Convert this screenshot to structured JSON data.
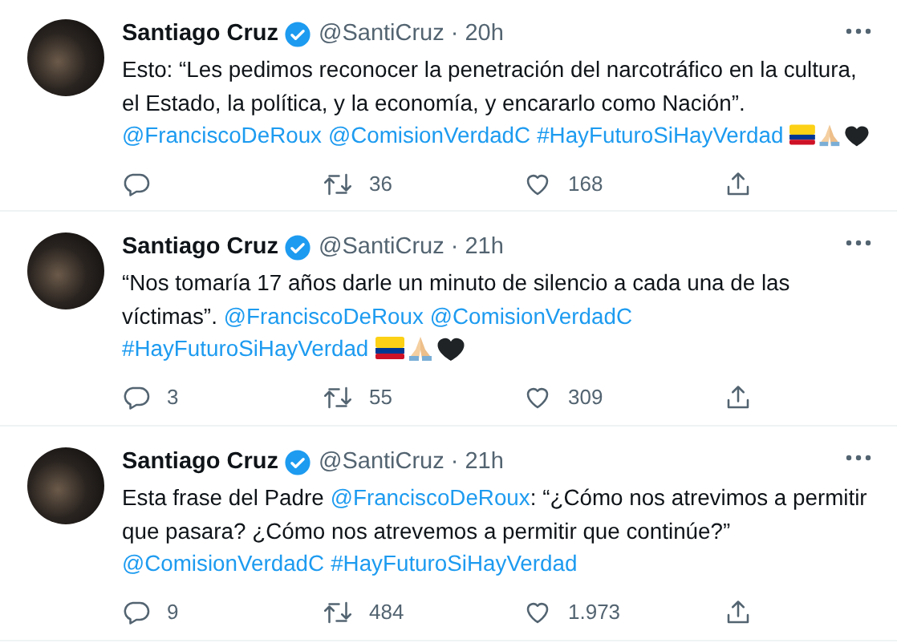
{
  "tweets": [
    {
      "name": "Santiago Cruz",
      "verified": true,
      "handle": "@SantiCruz",
      "separator": "·",
      "time": "20h",
      "lines": [
        [
          {
            "kind": "text",
            "text": "Esto: “Les pedimos reconocer la penetración del narcotráfico en la cultura,"
          }
        ],
        [
          {
            "kind": "text",
            "text": "el Estado, la política, y la economía, y encararlo como Nación”."
          }
        ],
        [
          {
            "kind": "link",
            "text": "@FranciscoDeRoux"
          },
          {
            "kind": "link",
            "text": "@ComisionVerdadC"
          },
          {
            "kind": "link",
            "text": "#HayFuturoSiHayVerdad"
          },
          {
            "kind": "flag"
          },
          {
            "kind": "hands"
          },
          {
            "kind": "heart"
          }
        ]
      ],
      "actions": [
        {
          "kind": "reply"
        },
        {
          "kind": "retweet",
          "count": "36"
        },
        {
          "kind": "like",
          "count": "168"
        },
        {
          "kind": "share"
        }
      ]
    },
    {
      "name": "Santiago Cruz",
      "verified": true,
      "handle": "@SantiCruz",
      "separator": "·",
      "time": "21h",
      "lines": [
        [
          {
            "kind": "text",
            "text": "“Nos tomaría 17 años darle un minuto de silencio a cada una de las"
          }
        ],
        [
          {
            "kind": "text",
            "text": "víctimas”."
          },
          {
            "kind": "link",
            "text": "@FranciscoDeRoux"
          },
          {
            "kind": "link",
            "text": "@ComisionVerdadC"
          }
        ],
        [
          {
            "kind": "link",
            "text": "#HayFuturoSiHayVerdad"
          },
          {
            "kind": "flag"
          },
          {
            "kind": "hands"
          },
          {
            "kind": "heart"
          }
        ]
      ],
      "actions": [
        {
          "kind": "reply",
          "count": "3"
        },
        {
          "kind": "retweet",
          "count": "55"
        },
        {
          "kind": "like",
          "count": "309"
        },
        {
          "kind": "share"
        }
      ]
    },
    {
      "name": "Santiago Cruz",
      "verified": true,
      "handle": "@SantiCruz",
      "separator": "·",
      "time": "21h",
      "lines": [
        [
          {
            "kind": "text",
            "text": "Esta frase del Padre"
          },
          {
            "kind": "link",
            "text": "@FranciscoDeRoux"
          },
          {
            "kind": "text",
            "text": ": “¿Cómo nos atrevimos a permitir"
          }
        ],
        [
          {
            "kind": "text",
            "text": "que pasara? ¿Cómo nos atrevemos a permitir que continúe?”"
          }
        ],
        [
          {
            "kind": "link",
            "text": "@ComisionVerdadC"
          },
          {
            "kind": "link",
            "text": "#HayFuturoSiHayVerdad"
          }
        ]
      ],
      "actions": [
        {
          "kind": "reply",
          "count": "9"
        },
        {
          "kind": "retweet",
          "count": "484"
        },
        {
          "kind": "like",
          "count": "1.973"
        },
        {
          "kind": "share"
        }
      ]
    }
  ]
}
